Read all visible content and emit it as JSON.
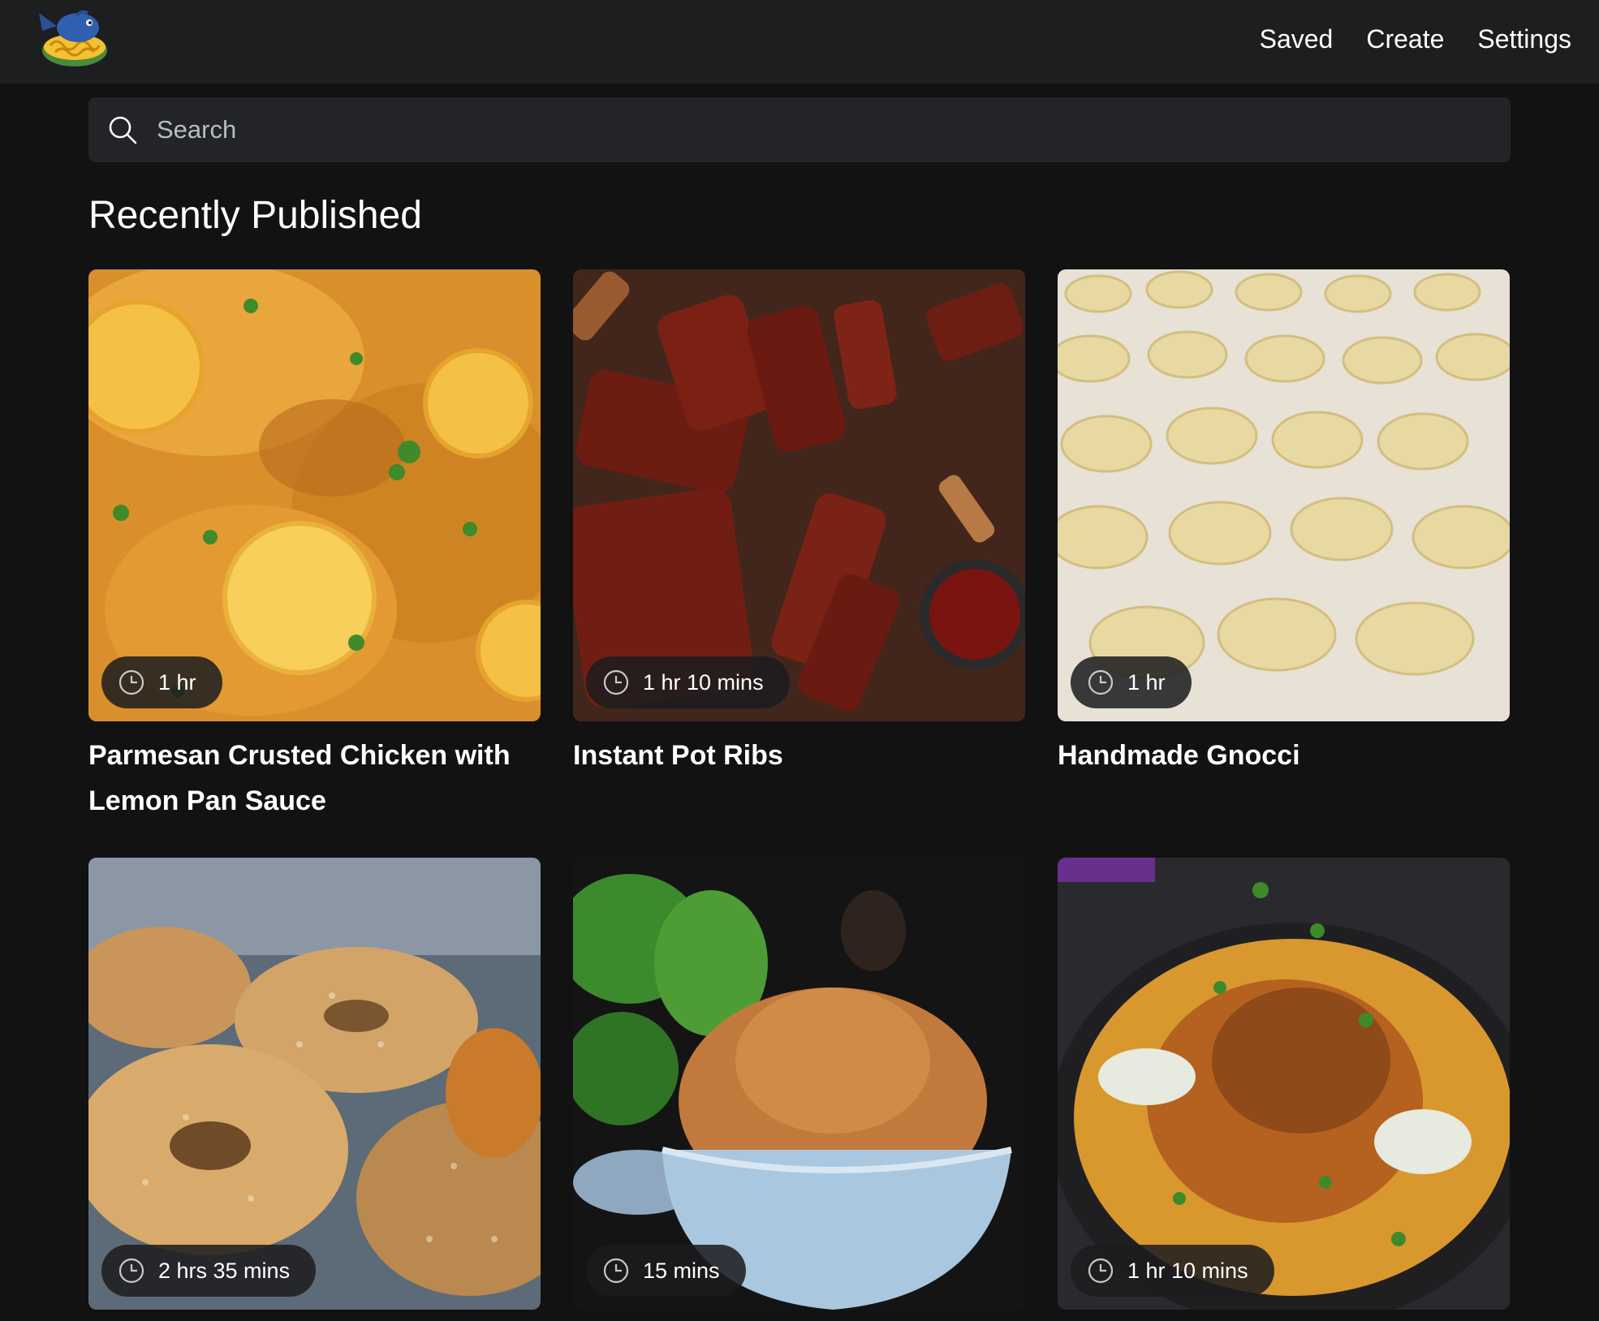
{
  "nav": {
    "logo_icon": "fish-noodle-bowl-logo",
    "links": [
      "Saved",
      "Create",
      "Settings"
    ]
  },
  "search": {
    "placeholder": "Search",
    "value": "",
    "icon": "search-icon"
  },
  "section": {
    "title": "Recently Published"
  },
  "recipes": [
    {
      "title": "Parmesan Crusted Chicken with Lemon Pan Sauce",
      "time": "1 hr",
      "image_icon": "chicken-lemon-photo"
    },
    {
      "title": "Instant Pot Ribs",
      "time": "1 hr 10 mins",
      "image_icon": "bbq-ribs-photo"
    },
    {
      "title": "Handmade Gnocci",
      "time": "1 hr",
      "image_icon": "gnocchi-photo"
    },
    {
      "title": "",
      "time": "2 hrs 35 mins",
      "image_icon": "bagels-photo"
    },
    {
      "title": "",
      "time": "15 mins",
      "image_icon": "spice-bowl-photo"
    },
    {
      "title": "",
      "time": "1 hr 10 mins",
      "image_icon": "chicken-rice-photo"
    }
  ],
  "colors": {
    "background": "#121213",
    "navbar": "#1d1e20",
    "search_bg": "#232428",
    "text": "#ffffff",
    "placeholder": "#b9bcc2"
  }
}
